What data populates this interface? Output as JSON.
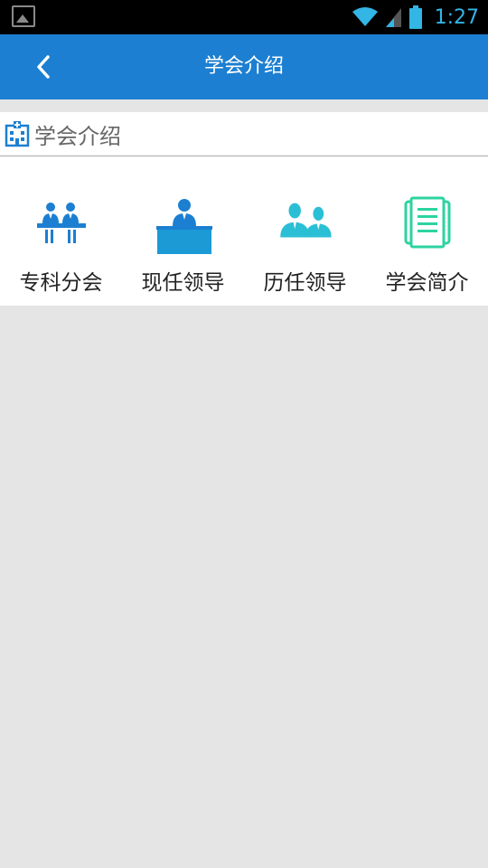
{
  "status_bar": {
    "time": "1:27",
    "icons": [
      "gallery-icon",
      "wifi-icon",
      "signal-icon",
      "battery-icon"
    ]
  },
  "app_bar": {
    "title": "学会介绍",
    "back_icon": "chevron-left-icon",
    "color": "#1c7fd1"
  },
  "section": {
    "title": "学会介绍",
    "icon": "building-icon"
  },
  "menu": {
    "items": [
      {
        "label": "专科分会",
        "icon": "committee-icon"
      },
      {
        "label": "现任领导",
        "icon": "leader-desk-icon"
      },
      {
        "label": "历任领导",
        "icon": "people-icon"
      },
      {
        "label": "学会简介",
        "icon": "document-icon"
      }
    ]
  },
  "colors": {
    "status_time": "#33b5e5",
    "icon_blue": "#1c7fd1",
    "icon_teal": "#2bbfd6",
    "icon_green": "#2cd3a0",
    "background": "#e5e5e5"
  }
}
